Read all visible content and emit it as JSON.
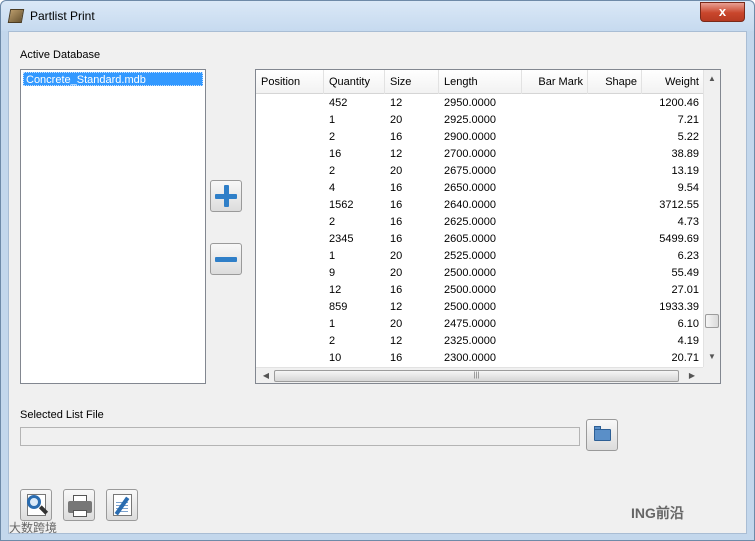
{
  "window": {
    "title": "Partlist Print",
    "close_label": "x"
  },
  "database": {
    "label": "Active Database",
    "items": [
      "Concrete_Standard.mdb"
    ]
  },
  "grid": {
    "columns": [
      "Position",
      "Quantity",
      "Size",
      "Length",
      "Bar Mark",
      "Shape",
      "Weight"
    ],
    "rows": [
      {
        "position": "",
        "quantity": "452",
        "size": "12",
        "length": "2950.0000",
        "bar_mark": "",
        "shape": "",
        "weight": "1200.46"
      },
      {
        "position": "",
        "quantity": "1",
        "size": "20",
        "length": "2925.0000",
        "bar_mark": "",
        "shape": "",
        "weight": "7.21"
      },
      {
        "position": "",
        "quantity": "2",
        "size": "16",
        "length": "2900.0000",
        "bar_mark": "",
        "shape": "",
        "weight": "5.22"
      },
      {
        "position": "",
        "quantity": "16",
        "size": "12",
        "length": "2700.0000",
        "bar_mark": "",
        "shape": "",
        "weight": "38.89"
      },
      {
        "position": "",
        "quantity": "2",
        "size": "20",
        "length": "2675.0000",
        "bar_mark": "",
        "shape": "",
        "weight": "13.19"
      },
      {
        "position": "",
        "quantity": "4",
        "size": "16",
        "length": "2650.0000",
        "bar_mark": "",
        "shape": "",
        "weight": "9.54"
      },
      {
        "position": "",
        "quantity": "1562",
        "size": "16",
        "length": "2640.0000",
        "bar_mark": "",
        "shape": "",
        "weight": "3712.55"
      },
      {
        "position": "",
        "quantity": "2",
        "size": "16",
        "length": "2625.0000",
        "bar_mark": "",
        "shape": "",
        "weight": "4.73"
      },
      {
        "position": "",
        "quantity": "2345",
        "size": "16",
        "length": "2605.0000",
        "bar_mark": "",
        "shape": "",
        "weight": "5499.69"
      },
      {
        "position": "",
        "quantity": "1",
        "size": "20",
        "length": "2525.0000",
        "bar_mark": "",
        "shape": "",
        "weight": "6.23"
      },
      {
        "position": "",
        "quantity": "9",
        "size": "20",
        "length": "2500.0000",
        "bar_mark": "",
        "shape": "",
        "weight": "55.49"
      },
      {
        "position": "",
        "quantity": "12",
        "size": "16",
        "length": "2500.0000",
        "bar_mark": "",
        "shape": "",
        "weight": "27.01"
      },
      {
        "position": "",
        "quantity": "859",
        "size": "12",
        "length": "2500.0000",
        "bar_mark": "",
        "shape": "",
        "weight": "1933.39"
      },
      {
        "position": "",
        "quantity": "1",
        "size": "20",
        "length": "2475.0000",
        "bar_mark": "",
        "shape": "",
        "weight": "6.10"
      },
      {
        "position": "",
        "quantity": "2",
        "size": "12",
        "length": "2325.0000",
        "bar_mark": "",
        "shape": "",
        "weight": "4.19"
      },
      {
        "position": "",
        "quantity": "10",
        "size": "16",
        "length": "2300.0000",
        "bar_mark": "",
        "shape": "",
        "weight": "20.71"
      }
    ]
  },
  "file": {
    "label": "Selected List File",
    "value": ""
  },
  "icons": {
    "add": "plus-icon",
    "remove": "minus-icon",
    "browse": "folder-icon",
    "preview": "magnifier-icon",
    "print": "printer-icon",
    "edit": "edit-icon"
  },
  "watermark": {
    "left": "大数跨境",
    "right": "ING前沿"
  }
}
